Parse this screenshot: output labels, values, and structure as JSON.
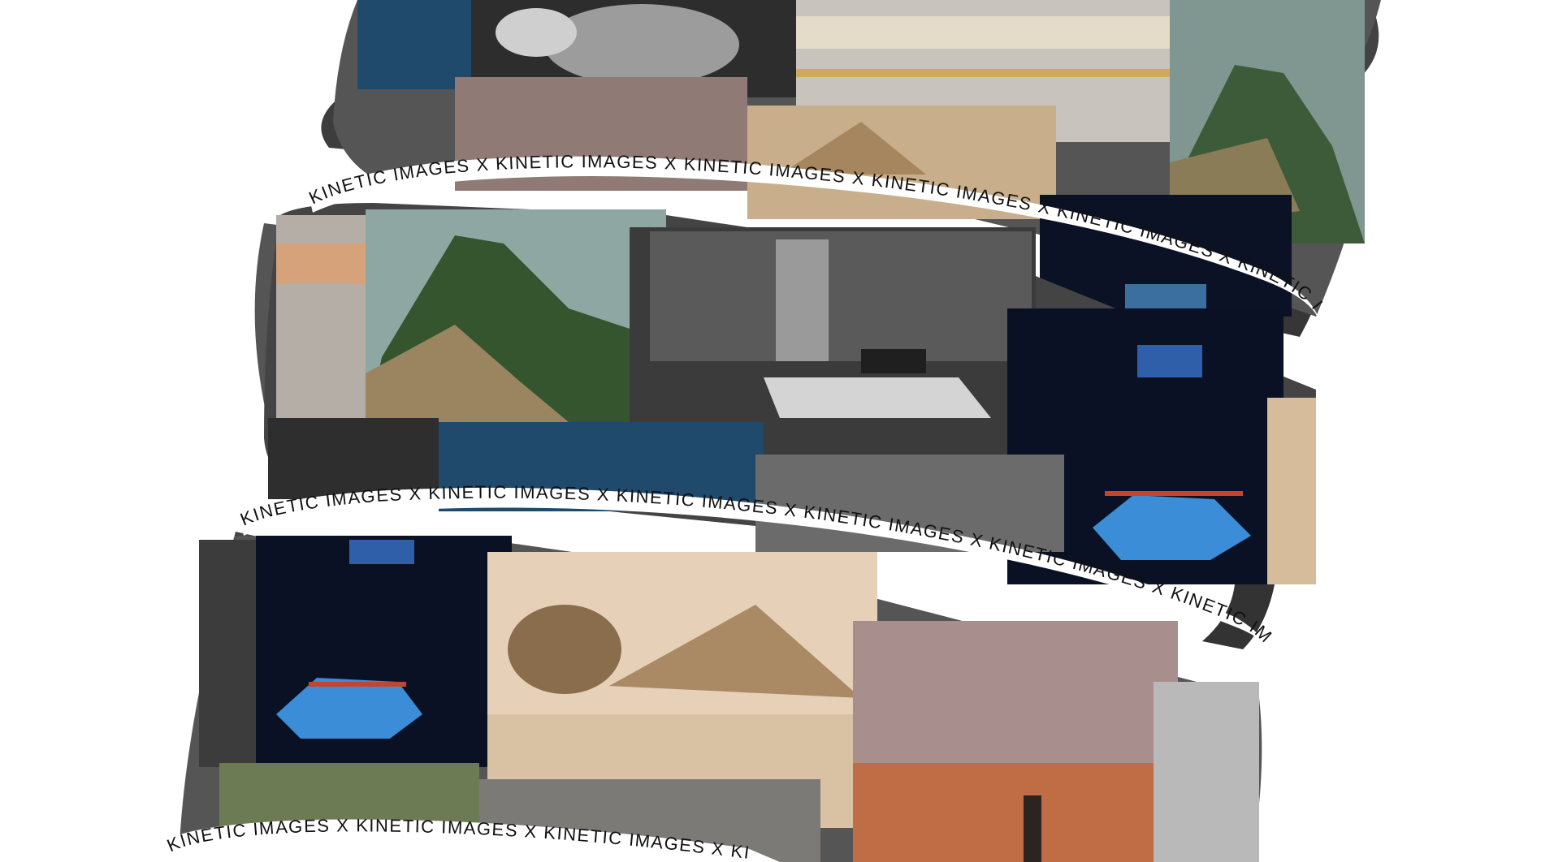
{
  "ribbon": {
    "phrase": "KINETIC IMAGES",
    "separator": "X",
    "text_color": "#111111",
    "band_color": "#ffffff"
  },
  "photos": [
    {
      "subject": "machu-picchu",
      "palette": [
        "#8fa7a3",
        "#3e5e3c",
        "#9b8460",
        "#6d7b55"
      ]
    },
    {
      "subject": "empty-hall-bench",
      "palette": [
        "#1a1a1a",
        "#5c5c5c",
        "#cfcfcf",
        "#3b3b3b"
      ]
    },
    {
      "subject": "boxing-arena",
      "palette": [
        "#0b1124",
        "#1c2541",
        "#c2462d",
        "#3a8dd6"
      ]
    },
    {
      "subject": "sphinx-pyramid",
      "palette": [
        "#e7d3bd",
        "#b99b75",
        "#8a6d4d",
        "#d9c2a4"
      ]
    },
    {
      "subject": "sunset-sky",
      "palette": [
        "#b7a8a8",
        "#8a6c68",
        "#c06d45",
        "#4d3b37"
      ]
    },
    {
      "subject": "motion-blur-platform",
      "palette": [
        "#c7c3bd",
        "#8e8d8a",
        "#d8b873",
        "#e9e9e9"
      ]
    },
    {
      "subject": "black-white-rocks",
      "palette": [
        "#111111",
        "#6b6b6b",
        "#d6d6d6",
        "#2f2f2f"
      ]
    },
    {
      "subject": "coastal-cliff",
      "palette": [
        "#1f4a6b",
        "#3d6f8f",
        "#a08e74",
        "#2a3440"
      ]
    }
  ]
}
